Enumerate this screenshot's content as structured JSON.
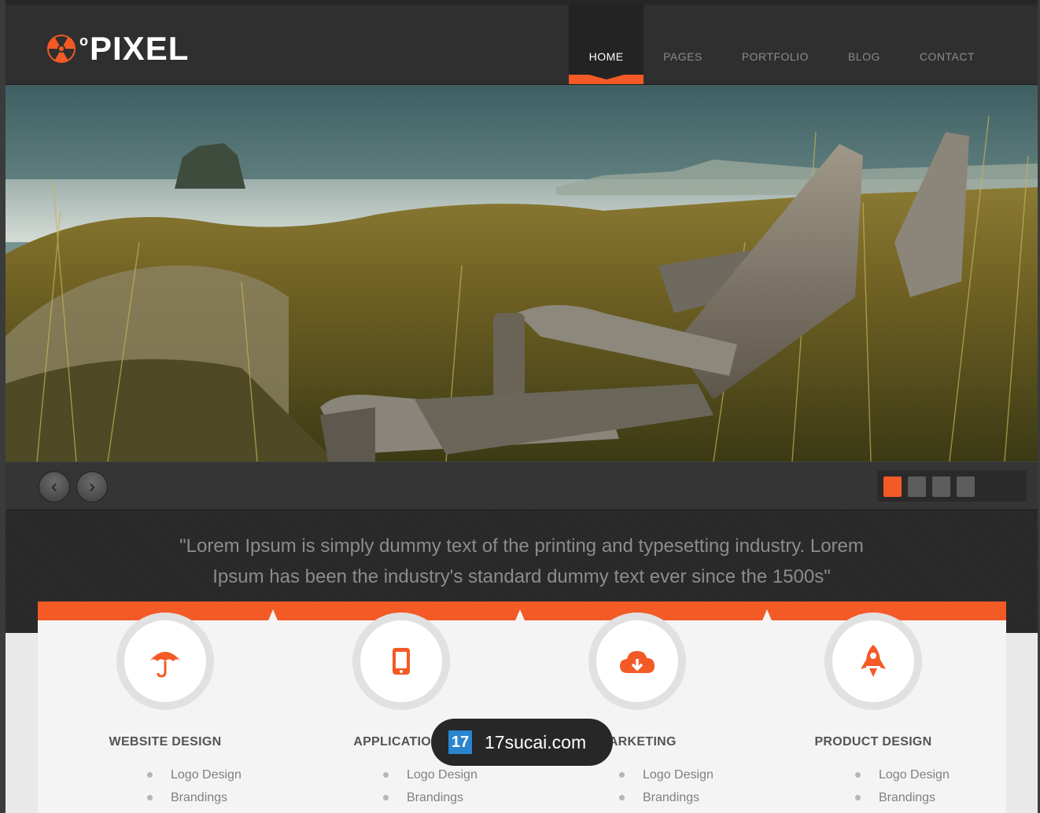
{
  "brand": {
    "name": "PIXEL",
    "superscript": "o",
    "accent_color": "#f35a26"
  },
  "nav": {
    "items": [
      {
        "label": "HOME",
        "active": true
      },
      {
        "label": "PAGES",
        "active": false
      },
      {
        "label": "PORTFOLIO",
        "active": false
      },
      {
        "label": "BLOG",
        "active": false
      },
      {
        "label": "CONTACT",
        "active": false
      }
    ]
  },
  "slider": {
    "prev_icon": "chevron-left-icon",
    "next_icon": "chevron-right-icon",
    "slide_count": 4,
    "active_slide": 1
  },
  "quote": {
    "line1": "\"Lorem Ipsum is simply dummy text of the printing and typesetting industry. Lorem",
    "line2": "Ipsum has been the industry's standard dummy text ever since the 1500s\""
  },
  "features": [
    {
      "title": "WEBSITE DESIGN",
      "icon": "umbrella-icon",
      "items": [
        "Logo Design",
        "Brandings"
      ]
    },
    {
      "title": "APPLICATIONS",
      "icon": "mobile-phone-icon",
      "items": [
        "Logo Design",
        "Brandings"
      ]
    },
    {
      "title": "MARKETING",
      "icon": "cloud-download-icon",
      "items": [
        "Logo Design",
        "Brandings"
      ]
    },
    {
      "title": "PRODUCT DESIGN",
      "icon": "rocket-icon",
      "items": [
        "Logo Design",
        "Brandings"
      ]
    }
  ],
  "watermark": {
    "logo_text": "17",
    "text": "17sucai.com"
  }
}
